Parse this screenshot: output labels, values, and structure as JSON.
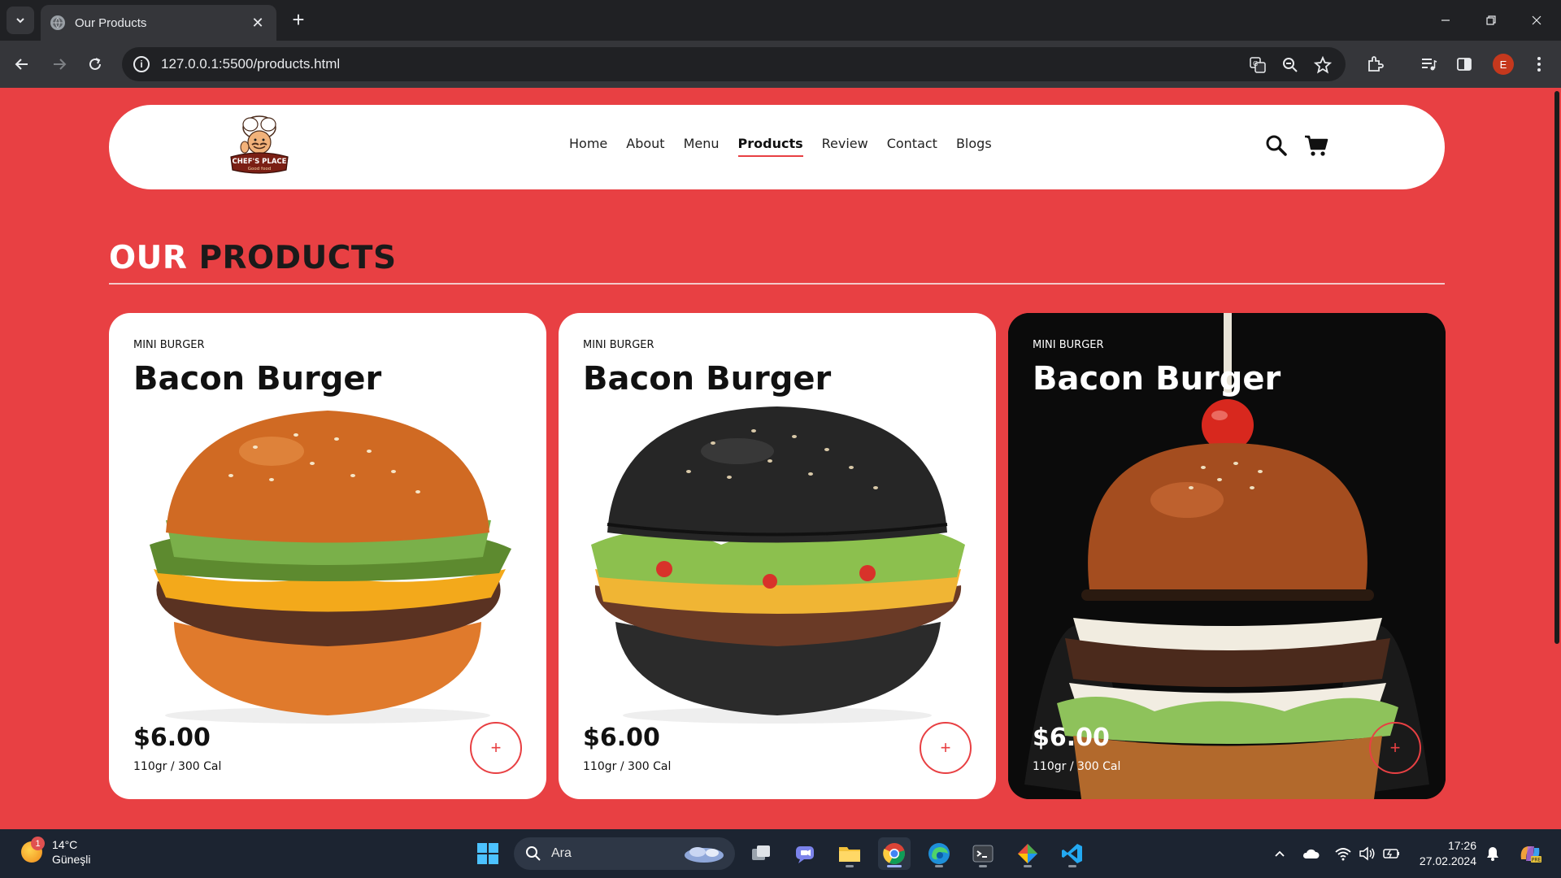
{
  "browser": {
    "tab_title": "Our Products",
    "url": "127.0.0.1:5500/products.html",
    "profile_initial": "E"
  },
  "site": {
    "logo_text": "CHEF'S PLACE",
    "logo_sub": "Good food",
    "nav": [
      {
        "label": "Home",
        "active": false
      },
      {
        "label": "About",
        "active": false
      },
      {
        "label": "Menu",
        "active": false
      },
      {
        "label": "Products",
        "active": true
      },
      {
        "label": "Review",
        "active": false
      },
      {
        "label": "Contact",
        "active": false
      },
      {
        "label": "Blogs",
        "active": false
      }
    ],
    "section_title_1": "OUR",
    "section_title_2": "PRODUCTS",
    "accent_color": "#e84043"
  },
  "products": [
    {
      "category": "MINI BURGER",
      "name": "Bacon Burger",
      "price": "$6.00",
      "info": "110gr / 300 Cal",
      "add_label": "+",
      "style": "light"
    },
    {
      "category": "MINI BURGER",
      "name": "Bacon Burger",
      "price": "$6.00",
      "info": "110gr / 300 Cal",
      "add_label": "+",
      "style": "light"
    },
    {
      "category": "MINI BURGER",
      "name": "Bacon Burger",
      "price": "$6.00",
      "info": "110gr / 300 Cal",
      "add_label": "+",
      "style": "dark"
    }
  ],
  "taskbar": {
    "weather_badge": "1",
    "temperature": "14°C",
    "condition": "Güneşli",
    "search_placeholder": "Ara",
    "time": "17:26",
    "date": "27.02.2024"
  }
}
